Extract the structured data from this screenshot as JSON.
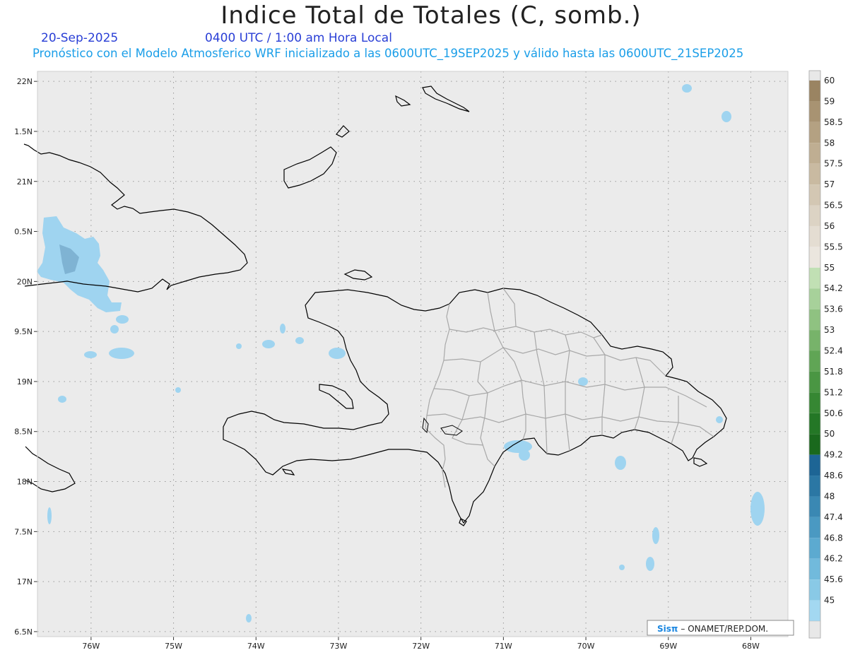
{
  "header": {
    "title": "Indice Total de Totales (C, somb.)",
    "date": "20-Sep-2025",
    "time": "0400 UTC / 1:00 am Hora Local",
    "forecast": "Pronóstico con el Modelo Atmosferico WRF inicializado a las 0600UTC_19SEP2025 y válido hasta las  0600UTC_21SEP2025"
  },
  "map": {
    "lat_range": [
      16.45,
      22.1
    ],
    "lon_range": [
      -76.65,
      -67.55
    ],
    "lat_labels": [
      "22N",
      "1.5N",
      "21N",
      "0.5N",
      "20N",
      "9.5N",
      "19N",
      "8.5N",
      "18N",
      "7.5N",
      "17N",
      "6.5N"
    ],
    "lon_labels": [
      "76W",
      "75W",
      "74W",
      "73W",
      "72W",
      "71W",
      "70W",
      "69W",
      "68W"
    ],
    "background_color": "#ebebeb",
    "coast_color": "#000000",
    "border_color": "#a8a8a8"
  },
  "colorbar": {
    "levels": [
      "60",
      "59",
      "58.5",
      "58",
      "57.5",
      "57",
      "56.5",
      "56",
      "55.5",
      "55",
      "54.2",
      "53.6",
      "53",
      "52.4",
      "51.8",
      "51.2",
      "50.6",
      "50",
      "49.2",
      "48.6",
      "48",
      "47.4",
      "46.8",
      "46.2",
      "45.6",
      "45"
    ],
    "colors": [
      "#9a8462",
      "#a89372",
      "#b4a182",
      "#bfae92",
      "#c9baa1",
      "#d3c7b3",
      "#dcd3c4",
      "#e4ddd2",
      "#ebe6de",
      "#c1e0b4",
      "#a7d19a",
      "#8fc281",
      "#77b36a",
      "#60a555",
      "#4a9643",
      "#368733",
      "#247726",
      "#1a691d",
      "#1d6595",
      "#2b77a4",
      "#3a88b3",
      "#4a99c2",
      "#5caad0",
      "#71badc",
      "#89c9e6",
      "#a3d8f1"
    ]
  },
  "credit": {
    "brand": "Sisπ",
    "text": "– ONAMET/REP.DOM."
  }
}
